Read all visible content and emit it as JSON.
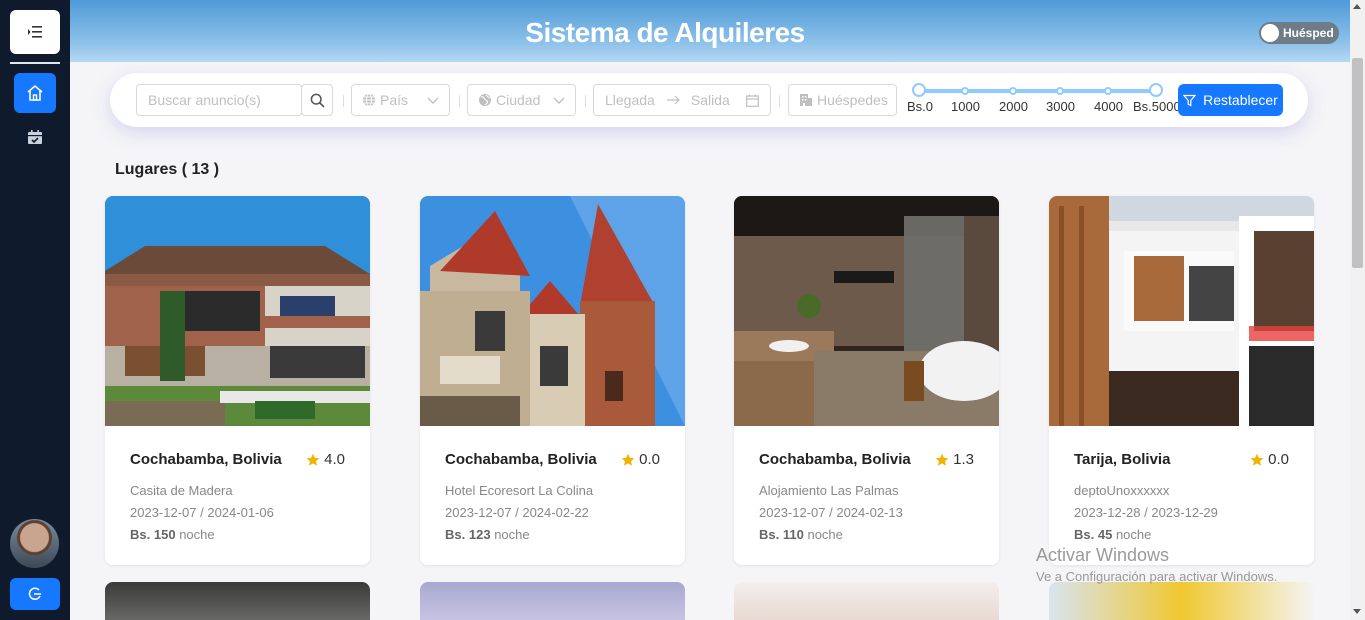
{
  "header": {
    "title": "Sistema de Alquileres",
    "role_toggle_label": "Huésped"
  },
  "sidebar": {
    "items": [
      "home-icon",
      "calendar-icon"
    ],
    "logout_icon": "logout-icon"
  },
  "filters": {
    "search_placeholder": "Buscar anuncio(s)",
    "country_placeholder": "País",
    "city_placeholder": "Ciudad",
    "arrival_placeholder": "Llegada",
    "departure_placeholder": "Salida",
    "guests_placeholder": "Huéspedes",
    "price_marks": [
      "Bs.0",
      "1000",
      "2000",
      "3000",
      "4000",
      "Bs.5000"
    ],
    "price_range": [
      0,
      5000
    ],
    "reset_label": "Restablecer"
  },
  "places": {
    "heading": "Lugares ( 13 )",
    "cards": [
      {
        "location": "Cochabamba, Bolivia",
        "rating": "4.0",
        "name": "Casita de Madera",
        "dates": "2023-12-07 / 2024-01-06",
        "currency": "Bs.",
        "price": "150",
        "unit": "noche"
      },
      {
        "location": "Cochabamba, Bolivia",
        "rating": "0.0",
        "name": "Hotel Ecoresort La Colina",
        "dates": "2023-12-07 / 2024-02-22",
        "currency": "Bs.",
        "price": "123",
        "unit": "noche"
      },
      {
        "location": "Cochabamba, Bolivia",
        "rating": "1.3",
        "name": "Alojamiento Las Palmas",
        "dates": "2023-12-07 / 2024-02-13",
        "currency": "Bs.",
        "price": "110",
        "unit": "noche"
      },
      {
        "location": "Tarija, Bolivia",
        "rating": "0.0",
        "name": "deptoUnoxxxxxx",
        "dates": "2023-12-28 / 2023-12-29",
        "currency": "Bs.",
        "price": "45",
        "unit": "noche"
      }
    ]
  },
  "watermark": {
    "line1": "Activar Windows",
    "line2": "Ve a Configuración para activar Windows."
  },
  "colors": {
    "accent": "#1677ff",
    "sidebar": "#0f1b2d",
    "star": "#fadb14"
  }
}
